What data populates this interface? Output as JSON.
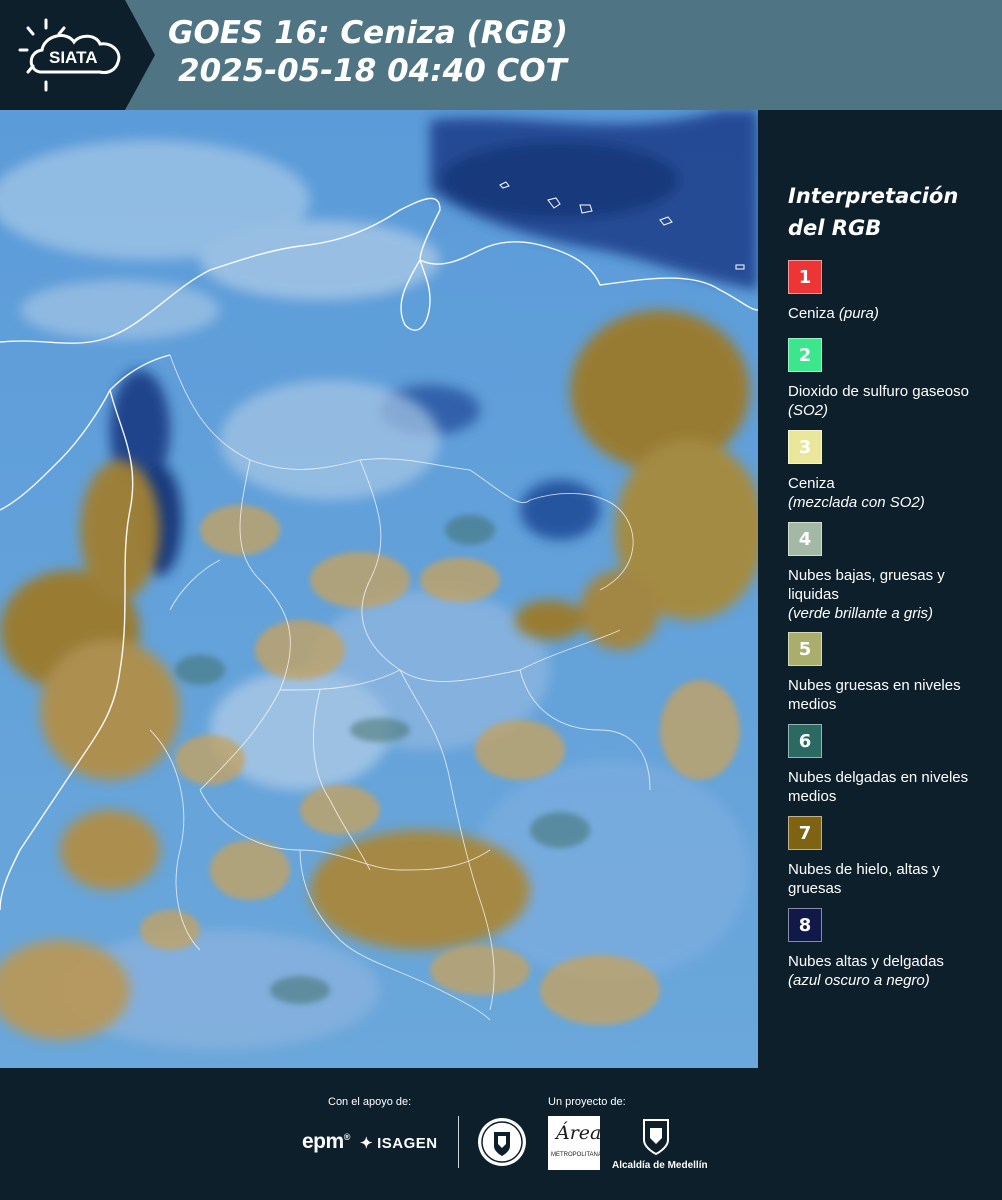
{
  "header": {
    "logo_text": "SIATA",
    "title_line1": "GOES 16: Ceniza (RGB)",
    "title_line2": "2025-05-18 04:40 COT"
  },
  "legend": {
    "title_line1": "Interpretación",
    "title_line2": "del RGB",
    "items": [
      {
        "num": "1",
        "color": "#ee3535",
        "text": "Ceniza ",
        "italic": "(pura)"
      },
      {
        "num": "2",
        "color": "#3ce68c",
        "text": "Dioxido de sulfuro gaseoso ",
        "italic": "(SO2)"
      },
      {
        "num": "3",
        "color": "#ebe79a",
        "text": "Ceniza",
        "italic": "(mezclada con SO2)"
      },
      {
        "num": "4",
        "color": "#a3b9a6",
        "text": "Nubes bajas, gruesas y liquidas",
        "italic": "(verde brillante a gris)"
      },
      {
        "num": "5",
        "color": "#aaae6d",
        "text": "Nubes gruesas en niveles medios",
        "italic": ""
      },
      {
        "num": "6",
        "color": "#2a6a62",
        "text": "Nubes delgadas en niveles medios",
        "italic": ""
      },
      {
        "num": "7",
        "color": "#7e6412",
        "text": "Nubes de hielo, altas y gruesas",
        "italic": ""
      },
      {
        "num": "8",
        "color": "#11184a",
        "text": "Nubes altas y delgadas",
        "italic": "(azul oscuro a negro)"
      }
    ]
  },
  "footer": {
    "support_label": "Con el apoyo de:",
    "project_label": "Un proyecto de:",
    "epm_text": "epm",
    "isagen_text": "ISAGEN",
    "area_text": "Área",
    "area_sub": "METROPOLITANA",
    "medellin_text": "Alcaldía de Medellín"
  }
}
